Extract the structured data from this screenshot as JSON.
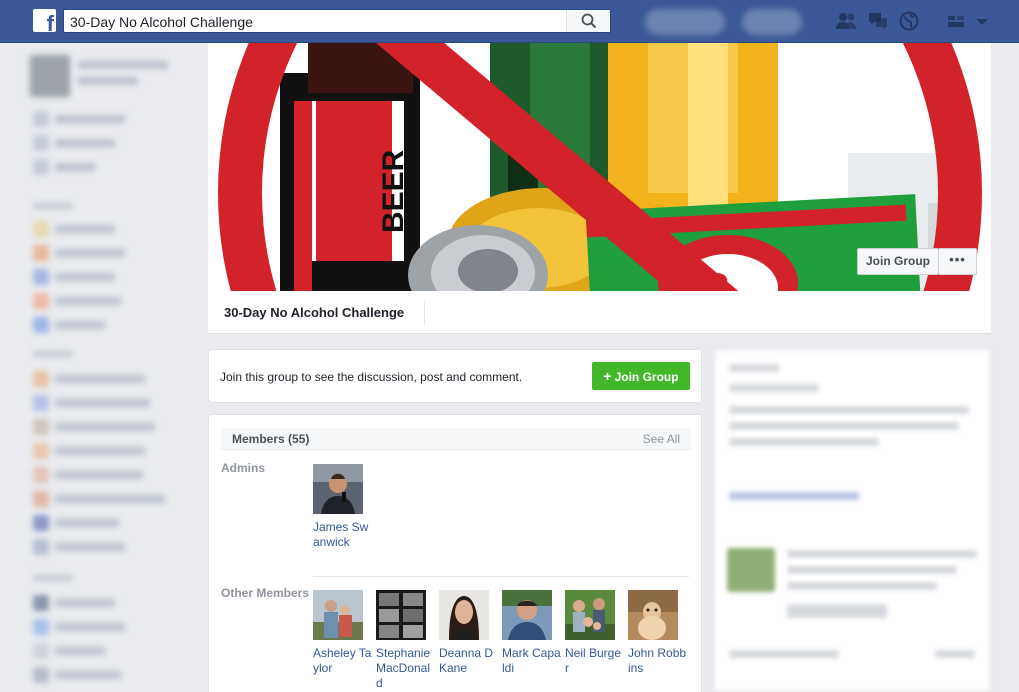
{
  "topbar": {
    "logo_letter": "f",
    "search_value": "30-Day No Alcohol Challenge",
    "icons": [
      "search-icon",
      "friend-requests-icon",
      "messages-icon",
      "notifications-globe-icon",
      "privacy-shortcuts-icon",
      "account-menu-chevron-icon"
    ]
  },
  "group": {
    "title": "30-Day No Alcohol Challenge",
    "join_button_label": "Join Group",
    "more_button_label": "•••"
  },
  "join_card": {
    "message": "Join this group to see the discussion, post and comment.",
    "button_label": "Join Group"
  },
  "members": {
    "title": "Members (55)",
    "see_all": "See All",
    "admins_label": "Admins",
    "others_label": "Other Members",
    "admins": [
      {
        "name": "James Swanwick"
      }
    ],
    "others": [
      {
        "name": "Asheley Taylor"
      },
      {
        "name": "Stephanie MacDonald"
      },
      {
        "name": "Deanna D Kane"
      },
      {
        "name": "Mark Capaldi"
      },
      {
        "name": "Neil Burger"
      },
      {
        "name": "John Robbins"
      }
    ]
  },
  "colors": {
    "topbar": "#3b5998",
    "join_green": "#42b72a",
    "link": "#365899",
    "page_bg": "#e9ebee"
  }
}
